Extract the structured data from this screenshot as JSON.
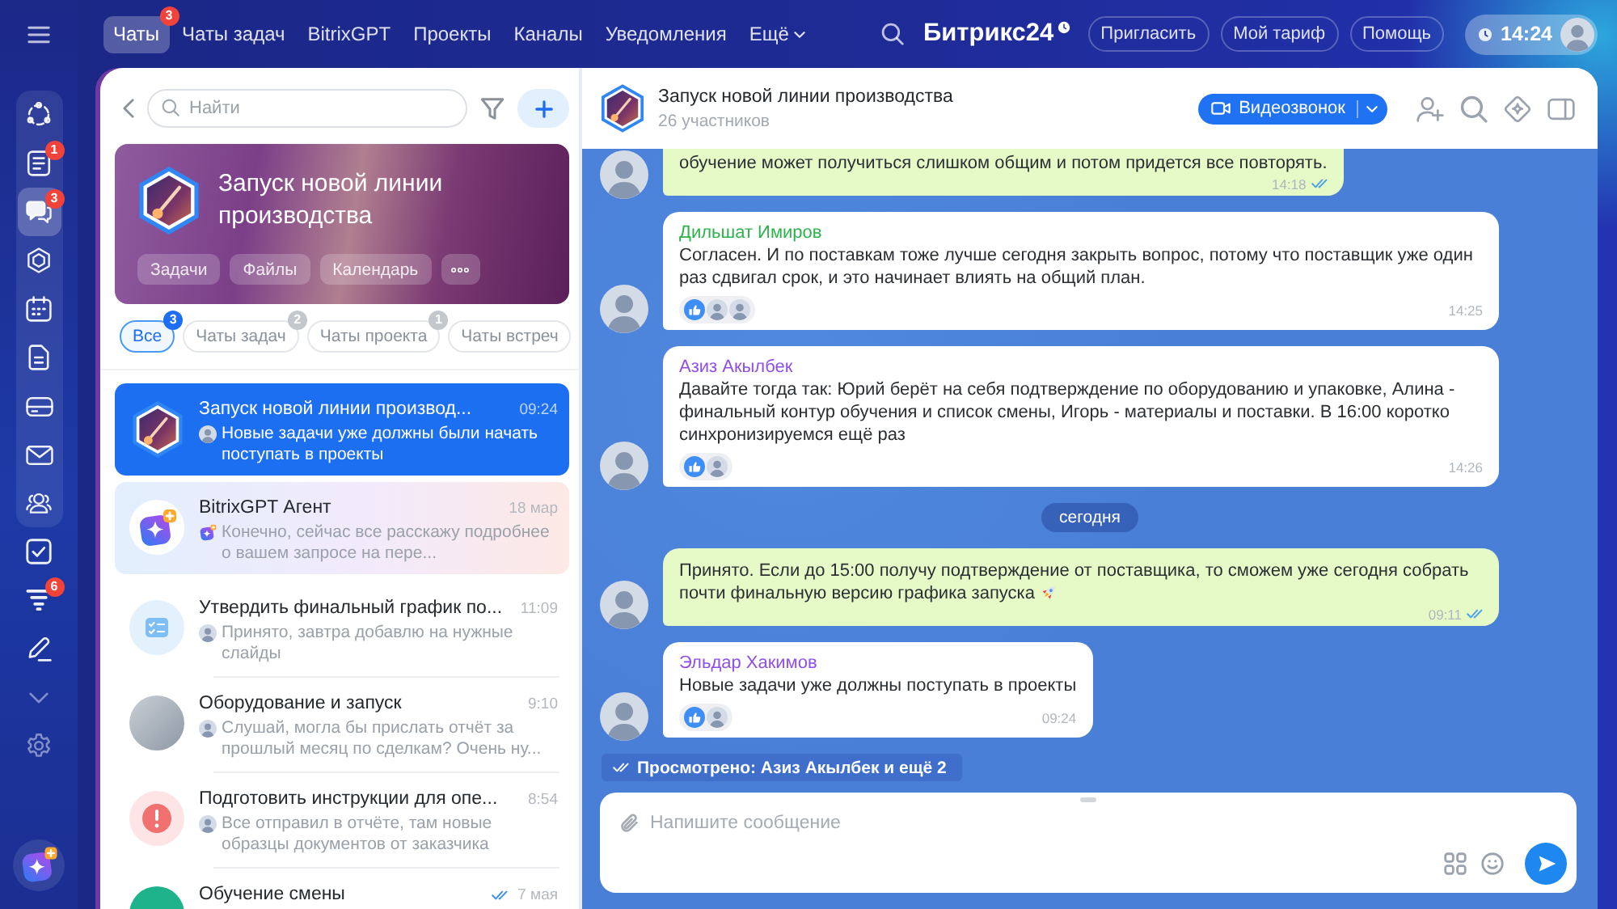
{
  "topbar": {
    "tabs": [
      {
        "label": "Чаты",
        "kind": "tab",
        "selected": true,
        "badge": "3"
      },
      {
        "label": "Чаты задач",
        "kind": "tab",
        "selected": false
      },
      {
        "label": "BitrixGPT",
        "kind": "tab",
        "selected": false
      },
      {
        "label": "Проекты",
        "kind": "tab",
        "selected": false
      },
      {
        "label": "Каналы",
        "kind": "tab",
        "selected": false
      },
      {
        "label": "Уведомления",
        "kind": "tab",
        "selected": false
      },
      {
        "label": "Ещё",
        "kind": "menu",
        "selected": false
      }
    ],
    "logo": "Битрикс24",
    "buttons": [
      "Пригласить",
      "Мой тариф",
      "Помощь"
    ],
    "time": "14:24"
  },
  "rail": {
    "groups": [
      {
        "kind": "panel",
        "items": [
          {
            "kind": "nodes",
            "selected": false
          },
          {
            "kind": "feed",
            "selected": false,
            "badge": "1"
          },
          {
            "kind": "chat",
            "selected": true,
            "badge": "3"
          },
          {
            "kind": "hexagon",
            "selected": false
          },
          {
            "kind": "calendar",
            "selected": false
          },
          {
            "kind": "document",
            "selected": false
          },
          {
            "kind": "tray",
            "selected": false
          },
          {
            "kind": "mail",
            "selected": false
          },
          {
            "kind": "people",
            "selected": false
          }
        ]
      },
      {
        "kind": "plain",
        "items": [
          {
            "kind": "tasks",
            "selected": false
          },
          {
            "kind": "funnel",
            "selected": false,
            "badge": "6"
          },
          {
            "kind": "pen",
            "selected": false
          },
          {
            "kind": "more",
            "selected": false
          },
          {
            "kind": "settings",
            "selected": false
          }
        ]
      }
    ]
  },
  "chat_list": {
    "search": {
      "placeholder": "Найти"
    },
    "banner": {
      "title": "Запуск новой линии производства",
      "chips": [
        {
          "kind": "text",
          "label": "Задачи"
        },
        {
          "kind": "text",
          "label": "Файлы"
        },
        {
          "kind": "text",
          "label": "Календарь"
        },
        {
          "kind": "more"
        }
      ]
    },
    "filters": [
      {
        "label": "Все",
        "selected": true,
        "badge": "3"
      },
      {
        "label": "Чаты задач",
        "selected": false,
        "badge": "2"
      },
      {
        "label": "Чаты проекта",
        "selected": false,
        "badge": "1"
      },
      {
        "label": "Чаты встреч",
        "selected": false
      }
    ],
    "chats": [
      {
        "kind": "chat",
        "avatar": {
          "kind": "hexagon"
        },
        "title": "Запуск новой линии производ...",
        "time": "09:24",
        "preview_icon": {
          "kind": "avatar"
        },
        "preview": "Новые задачи уже должны были начать поступать в проекты",
        "selected": true,
        "read": false
      },
      {
        "kind": "agent",
        "avatar": {
          "kind": "sparkle"
        },
        "title": "BitrixGPT Агент",
        "time": "18 мар",
        "preview_icon": {
          "kind": "sparkle"
        },
        "preview": "Конечно, сейчас все расскажу подробнее о вашем запросе на пере...",
        "selected": false,
        "read": false
      },
      {
        "kind": "chat",
        "avatar": {
          "kind": "checklist"
        },
        "title": "Утвердить финальный график по...",
        "time": "11:09",
        "preview_icon": {
          "kind": "avatar"
        },
        "preview": "Принято, завтра добавлю на нужные слайды",
        "selected": false,
        "read": false
      },
      {
        "kind": "chat",
        "avatar": {
          "kind": "photo"
        },
        "title": "Оборудование и запуск",
        "time": "9:10",
        "preview_icon": {
          "kind": "avatar"
        },
        "preview": "Слушай, могла бы прислать отчёт за прошлый месяц по сделкам? Очень ну...",
        "selected": false,
        "read": false
      },
      {
        "kind": "chat",
        "avatar": {
          "kind": "alert"
        },
        "title": "Подготовить инструкции для опе...",
        "time": "8:54",
        "preview_icon": {
          "kind": "avatar"
        },
        "preview": "Все отправил в отчёте, там новые образцы документов от заказчика",
        "selected": false,
        "read": false
      },
      {
        "kind": "chat",
        "avatar": {
          "kind": "plain"
        },
        "title": "Обучение смены",
        "time": "7 мая",
        "selected": false,
        "read": true
      }
    ]
  },
  "chat": {
    "title": "Запуск новой линии производства",
    "subtitle": "26 участников",
    "call_button": "Видеозвонок",
    "messages": [
      {
        "kind": "own",
        "text": "обучение может получиться слишком общим и потом придется все повторять.",
        "time": "14:18",
        "read": true
      },
      {
        "kind": "incoming",
        "author": "Дильшат Имиров",
        "color": "#2eb34b",
        "text": "Согласен. И по поставкам тоже лучше сегодня закрыть вопрос, потому что поставщик уже один раз сдвигал срок, и это начинает влиять на общий план.",
        "reactions": {
          "kind": "like",
          "reactors": [
            {
              "kind": "avatar"
            },
            {
              "kind": "avatar"
            }
          ]
        },
        "time": "14:25"
      },
      {
        "kind": "incoming",
        "author": "Азиз Акылбек",
        "color": "#8f4fe8",
        "text": "Давайте тогда так: Юрий берёт на себя подтверждение по оборудованию и упаковке, Алина - финальный контур обучения и список смены, Игорь - материалы и поставки. В 16:00 коротко синхронизируемся ещё раз",
        "reactions": {
          "kind": "like",
          "reactors": [
            {
              "kind": "avatar"
            }
          ]
        },
        "time": "14:26"
      },
      {
        "kind": "date",
        "text": "сегодня"
      },
      {
        "kind": "own",
        "text": "Принято. Если до 15:00 получу подтверждение от поставщика, то сможем уже сегодня собрать почти финальную версию графика запуска",
        "emoji": true,
        "time": "09:11",
        "read": true
      },
      {
        "kind": "incoming",
        "author": "Эльдар Хакимов",
        "color": "#8f4fe8",
        "text": "Новые задачи уже должны поступать в проекты",
        "reactions": {
          "kind": "like",
          "reactors": [
            {
              "kind": "avatar"
            }
          ]
        },
        "time": "09:24"
      }
    ],
    "seen": "Просмотрено: Азиз Акылбек и ещё 2",
    "composer": {
      "placeholder": "Напишите сообщение"
    }
  }
}
